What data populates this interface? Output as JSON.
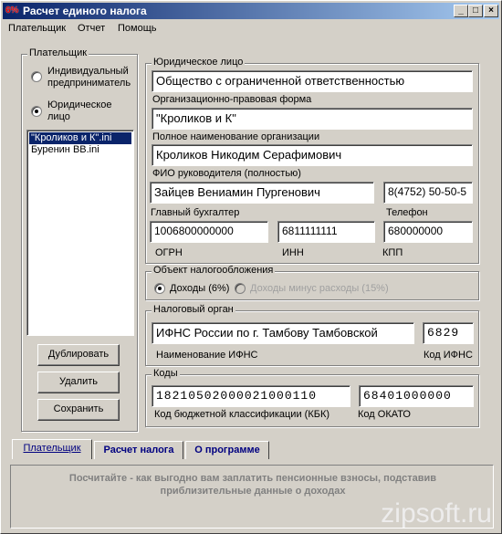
{
  "window": {
    "icon_text": "6%",
    "title": "Расчет единого налога",
    "min": "_",
    "max": "□",
    "close": "×"
  },
  "menu": [
    "Плательщик",
    "Отчет",
    "Помощь"
  ],
  "payer_group": {
    "title": "Плательщик",
    "options": [
      "Индивидуальный предприниматель",
      "Юридическое лицо"
    ],
    "selected": 1,
    "files": [
      "\"Кроликов и К\".ini",
      "Буренин ВВ.ini"
    ],
    "selected_file": 0,
    "buttons": [
      "Дублировать",
      "Удалить",
      "Сохранить"
    ]
  },
  "legal": {
    "title": "Юридическое лицо",
    "opf": "Общество с ограниченной ответственностью",
    "opf_label": "Организационно-правовая форма",
    "name": "\"Кроликов и К\"",
    "name_label": "Полное наименование организации",
    "head": "Кроликов Никодим Серафимович",
    "head_label": "ФИО руководителя (полностью)",
    "accountant": "Зайцев Вениамин Пургенович",
    "accountant_label": "Главный бухгалтер",
    "phone": "8(4752) 50-50-5",
    "phone_label": "Телефон",
    "ogrn": "1006800000000",
    "ogrn_label": "ОГРН",
    "inn": "6811111111",
    "inn_label": "ИНН",
    "kpp": "680000000",
    "kpp_label": "КПП"
  },
  "tax_object": {
    "title": "Объект налогообложения",
    "options": [
      "Доходы (6%)",
      "Доходы минус расходы (15%)"
    ],
    "selected": 0
  },
  "tax_authority": {
    "title": "Налоговый орган",
    "name": "ИФНС России по г. Тамбову Тамбовской",
    "name_label": "Наименование ИФНС",
    "code": "6829",
    "code_label": "Код ИФНС"
  },
  "codes": {
    "title": "Коды",
    "kbk": "18210502000021000110",
    "kbk_label": "Код бюджетной классификации (КБК)",
    "okato": "68401000000",
    "okato_label": "Код ОКАТО"
  },
  "tabs": [
    "Плательщик",
    "Расчет налога",
    "О программе"
  ],
  "active_tab": 0,
  "info_text": "Посчитайте - как выгодно вам заплатить пенсионные взносы, подставив приблизительные данные о доходах",
  "watermark": "zipsoft.ru"
}
